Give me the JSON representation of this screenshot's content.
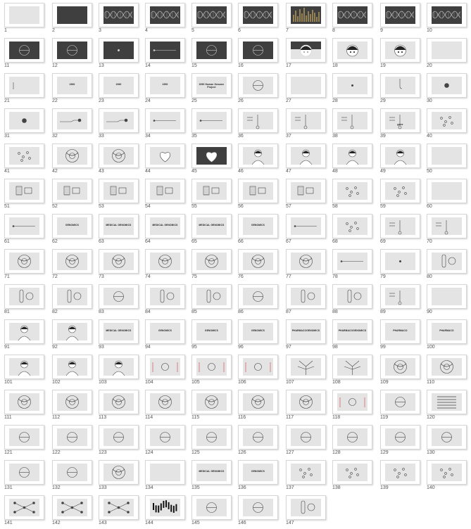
{
  "colors": {
    "background": "#ffffff",
    "panel_light": "#e4e4e4",
    "panel_dark": "#3f3f3f",
    "frame_border": "#d6d6d6",
    "arrow_red": "#d23c3c",
    "label_text": "#555555"
  },
  "thumbnails": [
    {
      "number": "1",
      "kind": "blank"
    },
    {
      "number": "2",
      "kind": "dark"
    },
    {
      "number": "3",
      "kind": "dark",
      "motif": "helix"
    },
    {
      "number": "4",
      "kind": "dark",
      "motif": "helix"
    },
    {
      "number": "5",
      "kind": "dark",
      "motif": "helix"
    },
    {
      "number": "6",
      "kind": "dark",
      "motif": "helix"
    },
    {
      "number": "7",
      "kind": "dark",
      "motif": "bars"
    },
    {
      "number": "8",
      "kind": "dark",
      "motif": "helix"
    },
    {
      "number": "9",
      "kind": "dark",
      "motif": "helix"
    },
    {
      "number": "10",
      "kind": "dark",
      "motif": "helix"
    },
    {
      "number": "11",
      "kind": "dark",
      "motif": "circle"
    },
    {
      "number": "12",
      "kind": "dark",
      "motif": "circle"
    },
    {
      "number": "13",
      "kind": "dark",
      "motif": "dot"
    },
    {
      "number": "14",
      "kind": "dark",
      "motif": "line"
    },
    {
      "number": "15",
      "kind": "dark",
      "motif": "circle"
    },
    {
      "number": "16",
      "kind": "dark",
      "motif": "circle"
    },
    {
      "number": "17",
      "kind": "dark-top",
      "motif": "face"
    },
    {
      "number": "18",
      "kind": "light",
      "motif": "face"
    },
    {
      "number": "19",
      "kind": "light",
      "motif": "face"
    },
    {
      "number": "20",
      "kind": "blank"
    },
    {
      "number": "21",
      "kind": "light",
      "motif": "tick"
    },
    {
      "number": "22",
      "kind": "light",
      "caption": "1960"
    },
    {
      "number": "23",
      "kind": "light",
      "caption": "1960"
    },
    {
      "number": "24",
      "kind": "light",
      "caption": "1990"
    },
    {
      "number": "25",
      "kind": "light",
      "caption": "1990 Human Genome Project"
    },
    {
      "number": "26",
      "kind": "light",
      "motif": "circle"
    },
    {
      "number": "27",
      "kind": "blank"
    },
    {
      "number": "28",
      "kind": "light",
      "motif": "dot"
    },
    {
      "number": "29",
      "kind": "light",
      "motif": "hook"
    },
    {
      "number": "30",
      "kind": "light",
      "motif": "blob"
    },
    {
      "number": "31",
      "kind": "light",
      "motif": "blob"
    },
    {
      "number": "32",
      "kind": "light",
      "motif": "hand"
    },
    {
      "number": "33",
      "kind": "light",
      "motif": "hand"
    },
    {
      "number": "34",
      "kind": "light",
      "motif": "line"
    },
    {
      "number": "35",
      "kind": "light",
      "motif": "line"
    },
    {
      "number": "36",
      "kind": "light",
      "motif": "figure"
    },
    {
      "number": "37",
      "kind": "light",
      "motif": "figure"
    },
    {
      "number": "38",
      "kind": "light",
      "motif": "figure"
    },
    {
      "number": "39",
      "kind": "light",
      "motif": "figure",
      "caption": "gene"
    },
    {
      "number": "40",
      "kind": "light",
      "motif": "scatter"
    },
    {
      "number": "41",
      "kind": "light",
      "motif": "scatter"
    },
    {
      "number": "42",
      "kind": "light",
      "motif": "cell"
    },
    {
      "number": "43",
      "kind": "light",
      "motif": "cell"
    },
    {
      "number": "44",
      "kind": "light",
      "motif": "heart"
    },
    {
      "number": "45",
      "kind": "dark",
      "motif": "heart"
    },
    {
      "number": "46",
      "kind": "light",
      "motif": "person"
    },
    {
      "number": "47",
      "kind": "light",
      "motif": "person"
    },
    {
      "number": "48",
      "kind": "light",
      "motif": "person"
    },
    {
      "number": "49",
      "kind": "light",
      "motif": "person"
    },
    {
      "number": "50",
      "kind": "blank"
    },
    {
      "number": "51",
      "kind": "light",
      "motif": "boxes"
    },
    {
      "number": "52",
      "kind": "light",
      "motif": "boxes"
    },
    {
      "number": "53",
      "kind": "light",
      "motif": "boxes"
    },
    {
      "number": "54",
      "kind": "light",
      "motif": "boxes"
    },
    {
      "number": "55",
      "kind": "light",
      "motif": "boxes"
    },
    {
      "number": "56",
      "kind": "light",
      "motif": "boxes"
    },
    {
      "number": "57",
      "kind": "light",
      "motif": "boxes"
    },
    {
      "number": "58",
      "kind": "light",
      "motif": "scatter"
    },
    {
      "number": "59",
      "kind": "light",
      "motif": "scatter"
    },
    {
      "number": "60",
      "kind": "blank"
    },
    {
      "number": "61",
      "kind": "light",
      "motif": "line"
    },
    {
      "number": "62",
      "kind": "light",
      "caption": "GENOMICS"
    },
    {
      "number": "63",
      "kind": "light",
      "caption": "MEDICAL GENOMICS"
    },
    {
      "number": "64",
      "kind": "light",
      "caption": "MEDICAL GENOMICS"
    },
    {
      "number": "65",
      "kind": "light",
      "caption": "MEDICAL GENOMICS"
    },
    {
      "number": "66",
      "kind": "light",
      "caption": "GENOMICS"
    },
    {
      "number": "67",
      "kind": "light",
      "motif": "line"
    },
    {
      "number": "68",
      "kind": "light",
      "motif": "scatter"
    },
    {
      "number": "69",
      "kind": "light",
      "motif": "figure"
    },
    {
      "number": "70",
      "kind": "light",
      "motif": "figure"
    },
    {
      "number": "71",
      "kind": "light",
      "motif": "cell"
    },
    {
      "number": "72",
      "kind": "light",
      "motif": "cell"
    },
    {
      "number": "73",
      "kind": "light",
      "motif": "cell"
    },
    {
      "number": "74",
      "kind": "light",
      "motif": "cell"
    },
    {
      "number": "75",
      "kind": "light",
      "motif": "cell"
    },
    {
      "number": "76",
      "kind": "light",
      "motif": "cell"
    },
    {
      "number": "77",
      "kind": "light",
      "motif": "cell"
    },
    {
      "number": "78",
      "kind": "light",
      "motif": "line"
    },
    {
      "number": "79",
      "kind": "light",
      "motif": "dot"
    },
    {
      "number": "80",
      "kind": "light",
      "motif": "tube"
    },
    {
      "number": "81",
      "kind": "light",
      "motif": "tube"
    },
    {
      "number": "82",
      "kind": "light",
      "motif": "tube"
    },
    {
      "number": "83",
      "kind": "light",
      "motif": "circle"
    },
    {
      "number": "84",
      "kind": "light",
      "motif": "tube"
    },
    {
      "number": "85",
      "kind": "light",
      "motif": "tube"
    },
    {
      "number": "86",
      "kind": "light",
      "motif": "circle"
    },
    {
      "number": "87",
      "kind": "light",
      "motif": "tube"
    },
    {
      "number": "88",
      "kind": "light",
      "motif": "tube"
    },
    {
      "number": "89",
      "kind": "light",
      "motif": "figure"
    },
    {
      "number": "90",
      "kind": "blank"
    },
    {
      "number": "91",
      "kind": "light",
      "motif": "person"
    },
    {
      "number": "92",
      "kind": "light",
      "motif": "person"
    },
    {
      "number": "93",
      "kind": "light",
      "caption": "MEDICAL GENOMICS"
    },
    {
      "number": "94",
      "kind": "light",
      "caption": "GENOMICS"
    },
    {
      "number": "95",
      "kind": "light",
      "caption": "GENOMICS"
    },
    {
      "number": "96",
      "kind": "light",
      "caption": "GENOMICS"
    },
    {
      "number": "97",
      "kind": "light",
      "caption": "PHARMACOGENOMICS"
    },
    {
      "number": "98",
      "kind": "light",
      "caption": "PHARMACOGENOMICS"
    },
    {
      "number": "99",
      "kind": "light",
      "caption": "PHARMACO"
    },
    {
      "number": "100",
      "kind": "light",
      "caption": "PHARMACO"
    },
    {
      "number": "101",
      "kind": "light",
      "motif": "person"
    },
    {
      "number": "102",
      "kind": "light",
      "motif": "person"
    },
    {
      "number": "103",
      "kind": "light",
      "motif": "person"
    },
    {
      "number": "104",
      "kind": "light",
      "motif": "arrows"
    },
    {
      "number": "105",
      "kind": "light",
      "motif": "arrows"
    },
    {
      "number": "106",
      "kind": "light",
      "motif": "arrows"
    },
    {
      "number": "107",
      "kind": "light",
      "motif": "tree"
    },
    {
      "number": "108",
      "kind": "light",
      "motif": "tree"
    },
    {
      "number": "109",
      "kind": "light",
      "motif": "cell"
    },
    {
      "number": "110",
      "kind": "light",
      "motif": "cell"
    },
    {
      "number": "111",
      "kind": "light",
      "motif": "cell"
    },
    {
      "number": "112",
      "kind": "light",
      "motif": "cell"
    },
    {
      "number": "113",
      "kind": "light",
      "motif": "cell"
    },
    {
      "number": "114",
      "kind": "light",
      "motif": "cell"
    },
    {
      "number": "115",
      "kind": "light",
      "motif": "cell"
    },
    {
      "number": "116",
      "kind": "light",
      "motif": "cell"
    },
    {
      "number": "117",
      "kind": "light",
      "motif": "cell"
    },
    {
      "number": "118",
      "kind": "light",
      "motif": "arrows"
    },
    {
      "number": "119",
      "kind": "light",
      "motif": "circle"
    },
    {
      "number": "120",
      "kind": "light",
      "motif": "lines"
    },
    {
      "number": "121",
      "kind": "light",
      "motif": "circle"
    },
    {
      "number": "122",
      "kind": "light",
      "motif": "circle"
    },
    {
      "number": "123",
      "kind": "light",
      "motif": "circle"
    },
    {
      "number": "124",
      "kind": "light",
      "motif": "circle"
    },
    {
      "number": "125",
      "kind": "light",
      "motif": "circle"
    },
    {
      "number": "126",
      "kind": "light",
      "motif": "circle"
    },
    {
      "number": "127",
      "kind": "light",
      "motif": "circle"
    },
    {
      "number": "128",
      "kind": "light",
      "motif": "circle"
    },
    {
      "number": "129",
      "kind": "light",
      "motif": "circle"
    },
    {
      "number": "130",
      "kind": "light",
      "motif": "circle"
    },
    {
      "number": "131",
      "kind": "light",
      "motif": "circle"
    },
    {
      "number": "132",
      "kind": "light",
      "motif": "circle"
    },
    {
      "number": "133",
      "kind": "light",
      "motif": "cell"
    },
    {
      "number": "134",
      "kind": "blank"
    },
    {
      "number": "135",
      "kind": "light",
      "caption": "MEDICAL GENOMICS"
    },
    {
      "number": "136",
      "kind": "light",
      "caption": "GENOMICS"
    },
    {
      "number": "137",
      "kind": "light",
      "motif": "scatter"
    },
    {
      "number": "138",
      "kind": "light",
      "motif": "scatter"
    },
    {
      "number": "139",
      "kind": "light",
      "motif": "scatter"
    },
    {
      "number": "140",
      "kind": "light",
      "motif": "scatter"
    },
    {
      "number": "141",
      "kind": "light",
      "motif": "network"
    },
    {
      "number": "142",
      "kind": "light",
      "motif": "network"
    },
    {
      "number": "143",
      "kind": "light",
      "motif": "network"
    },
    {
      "number": "144",
      "kind": "light",
      "motif": "helix-bw"
    },
    {
      "number": "145",
      "kind": "light",
      "motif": "circle"
    },
    {
      "number": "146",
      "kind": "light",
      "motif": "circle"
    },
    {
      "number": "147",
      "kind": "light",
      "motif": "tube"
    }
  ]
}
